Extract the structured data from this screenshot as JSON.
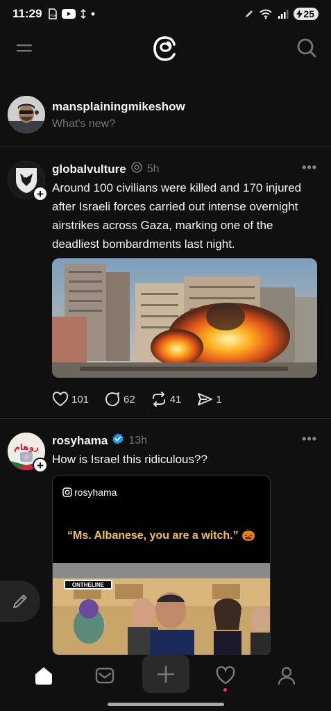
{
  "status_bar": {
    "time": "11:29",
    "battery": "25"
  },
  "top_bar": {
    "menu_icon": "menu-icon",
    "logo_icon": "threads-logo-icon",
    "search_icon": "search-icon"
  },
  "composer": {
    "username": "mansplainingmikeshow",
    "prompt": "What's new?"
  },
  "feed": [
    {
      "author": "globalvulture",
      "time": "5h",
      "text": "Around 100 civilians were killed and 170 injured after Israeli forces carried out intense overnight airstrikes across Gaza, marking one of the deadliest bombardments last night.",
      "likes": "101",
      "replies": "62",
      "reposts": "41",
      "shares": "1"
    },
    {
      "author": "rosyhama",
      "time": "13h",
      "verified": true,
      "text": "How is Israel this ridiculous??",
      "media": {
        "handle": "rosyhama",
        "quote": "“Ms. Albanese, you are a witch.”",
        "emoji": "🎃",
        "banner": "ONTHELINE"
      }
    }
  ],
  "colors": {
    "background": "#101010",
    "verified": "#1d9bf0",
    "notification_dot": "#ff3040",
    "quote_text": "#f5c24a"
  },
  "bottom_nav": {
    "items": [
      "home-icon",
      "feed-icon",
      "create-icon",
      "activity-icon",
      "profile-icon"
    ]
  }
}
